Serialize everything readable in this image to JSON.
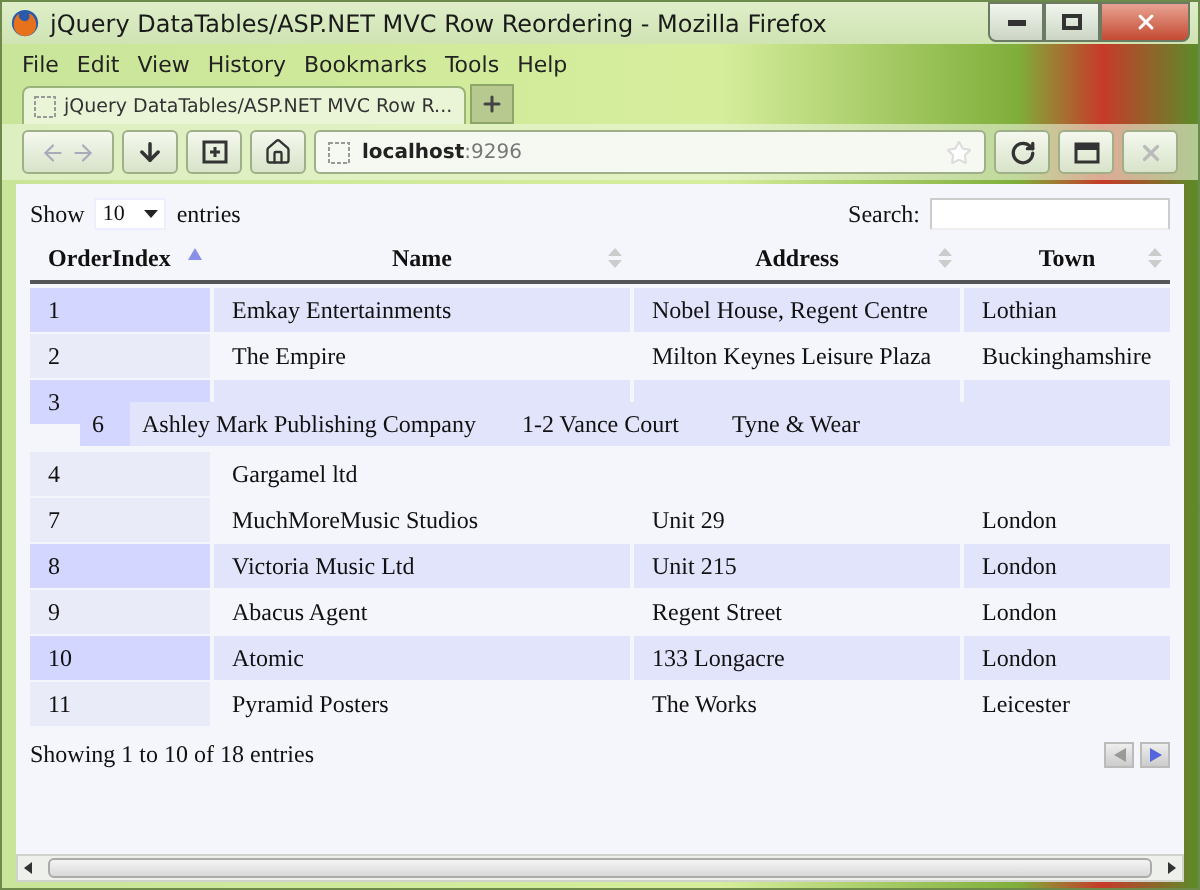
{
  "window": {
    "title": "jQuery DataTables/ASP.NET MVC Row Reordering - Mozilla Firefox"
  },
  "menu": [
    "File",
    "Edit",
    "View",
    "History",
    "Bookmarks",
    "Tools",
    "Help"
  ],
  "tabs": [
    {
      "label": "jQuery DataTables/ASP.NET MVC Row R...",
      "selected": true
    }
  ],
  "address_bar": {
    "host": "localhost",
    "port": ":9296"
  },
  "table_controls": {
    "show_label": "Show",
    "length": "10",
    "entries_label": "entries",
    "search_label": "Search:"
  },
  "table": {
    "columns": [
      {
        "label": "OrderIndex",
        "sorted": true
      },
      {
        "label": "Name",
        "sorted": false
      },
      {
        "label": "Address",
        "sorted": false
      },
      {
        "label": "Town",
        "sorted": false
      }
    ],
    "rows": [
      {
        "kind": "data",
        "shaded": true,
        "cells": [
          "1",
          "Emkay Entertainments",
          "Nobel House, Regent Centre",
          "Lothian"
        ]
      },
      {
        "kind": "data",
        "shaded": false,
        "cells": [
          "2",
          "The Empire",
          "Milton Keynes Leisure Plaza",
          "Buckinghamshire"
        ]
      },
      {
        "kind": "data",
        "shaded": true,
        "dragged_over": true,
        "cells": [
          "3"
        ]
      },
      {
        "kind": "placeholder"
      },
      {
        "kind": "data",
        "shaded": false,
        "cells": [
          "4",
          "Gargamel ltd"
        ]
      },
      {
        "kind": "data",
        "shaded": false,
        "cells": [
          "7",
          "MuchMoreMusic Studios",
          "Unit 29",
          "London"
        ]
      },
      {
        "kind": "data",
        "shaded": true,
        "cells": [
          "8",
          "Victoria Music Ltd",
          "Unit 215",
          "London"
        ]
      },
      {
        "kind": "data",
        "shaded": false,
        "cells": [
          "9",
          "Abacus Agent",
          "Regent Street",
          "London"
        ]
      },
      {
        "kind": "data",
        "shaded": true,
        "cells": [
          "10",
          "Atomic",
          "133 Longacre",
          "London"
        ]
      },
      {
        "kind": "data",
        "shaded": false,
        "cells": [
          "11",
          "Pyramid Posters",
          "The Works",
          "Leicester"
        ]
      }
    ],
    "dragged_row": {
      "cells": [
        "6",
        "Ashley Mark Publishing Company",
        "1-2 Vance Court",
        "Tyne & Wear"
      ]
    }
  },
  "info": "Showing 1 to 10 of 18 entries",
  "paging": {
    "previous_disabled": true,
    "next_disabled": false
  }
}
